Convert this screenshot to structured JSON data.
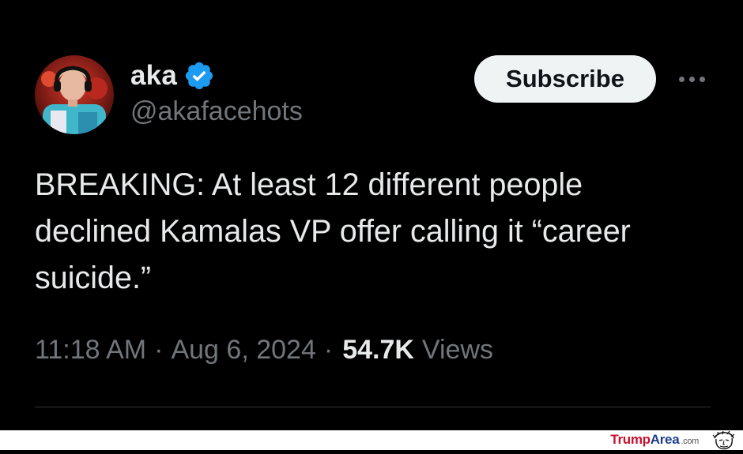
{
  "colors": {
    "background": "#000000",
    "text_primary": "#e7e9ea",
    "text_secondary": "#71767b",
    "verified_blue": "#1d9bf0",
    "button_bg": "#eff3f4",
    "button_text": "#0f1419",
    "divider": "#2f3336",
    "watermark_red": "#c8102e",
    "watermark_blue": "#1d3f8f"
  },
  "author": {
    "display_name": "aka",
    "handle": "@akafacehots",
    "verified_icon": "verified-badge-icon",
    "avatar_icon": "profile-avatar"
  },
  "actions": {
    "subscribe_label": "Subscribe",
    "more_icon": "more-horizontal-icon"
  },
  "tweet": {
    "text": "BREAKING: At least 12 different people\ndeclined Kamalas VP offer calling it “career\nsuicide.”",
    "time": "11:18 AM",
    "separator": "·",
    "date": "Aug 6, 2024",
    "views_count": "54.7K",
    "views_label": "Views"
  },
  "watermark": {
    "part1": "Trump",
    "part2": "Area",
    "part3": ".com",
    "face_icon": "cartoon-face-icon"
  }
}
